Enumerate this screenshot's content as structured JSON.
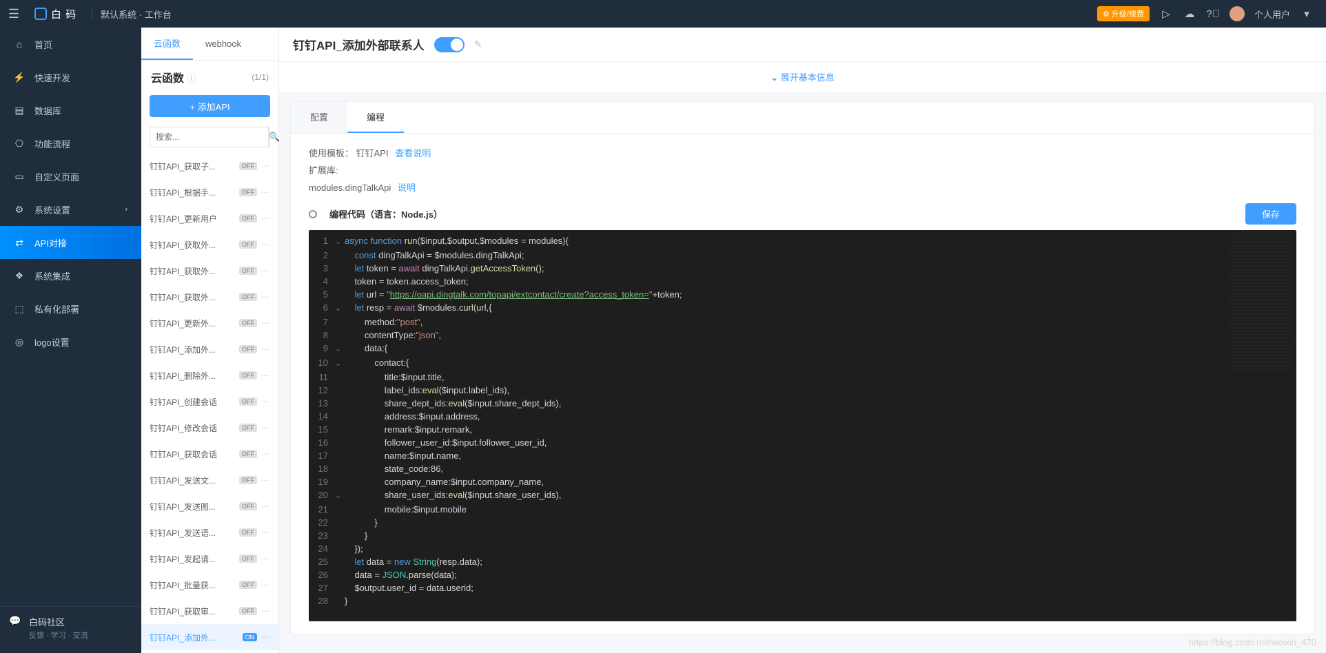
{
  "topbar": {
    "logo_text": "白 码",
    "breadcrumb": "默认系统 · 工作台",
    "upgrade": "升级/续费",
    "user": "个人用户"
  },
  "sidebar": {
    "items": [
      {
        "icon": "home",
        "label": "首页"
      },
      {
        "icon": "dev",
        "label": "快速开发"
      },
      {
        "icon": "db",
        "label": "数据库"
      },
      {
        "icon": "flow",
        "label": "功能流程"
      },
      {
        "icon": "page",
        "label": "自定义页面"
      },
      {
        "icon": "settings",
        "label": "系统设置",
        "arrow": true
      },
      {
        "icon": "api",
        "label": "API对接",
        "active": true
      },
      {
        "icon": "integrate",
        "label": "系统集成"
      },
      {
        "icon": "deploy",
        "label": "私有化部署"
      },
      {
        "icon": "logo",
        "label": "logo设置"
      }
    ],
    "footer_title": "白码社区",
    "footer_sub": "反馈 · 学习 · 交流"
  },
  "midpanel": {
    "tabs": [
      {
        "label": "云函数",
        "active": true
      },
      {
        "label": "webhook"
      }
    ],
    "title": "云函数",
    "count": "(1/1)",
    "add_btn": "+  添加API",
    "search_placeholder": "搜索...",
    "api_items": [
      {
        "name": "钉钉API_获取子...",
        "on": false
      },
      {
        "name": "钉钉API_根据手...",
        "on": false
      },
      {
        "name": "钉钉API_更新用户",
        "on": false
      },
      {
        "name": "钉钉API_获取外...",
        "on": false
      },
      {
        "name": "钉钉API_获取外...",
        "on": false
      },
      {
        "name": "钉钉API_获取外...",
        "on": false
      },
      {
        "name": "钉钉API_更新外...",
        "on": false
      },
      {
        "name": "钉钉API_添加外...",
        "on": false
      },
      {
        "name": "钉钉API_删除外...",
        "on": false
      },
      {
        "name": "钉钉API_创建会话",
        "on": false
      },
      {
        "name": "钉钉API_修改会话",
        "on": false
      },
      {
        "name": "钉钉API_获取会话",
        "on": false
      },
      {
        "name": "钉钉API_发送文...",
        "on": false
      },
      {
        "name": "钉钉API_发送图...",
        "on": false
      },
      {
        "name": "钉钉API_发送语...",
        "on": false
      },
      {
        "name": "钉钉API_发起请...",
        "on": false
      },
      {
        "name": "钉钉API_批量获...",
        "on": false
      },
      {
        "name": "钉钉API_获取审...",
        "on": false
      },
      {
        "name": "钉钉API_添加外...",
        "on": true,
        "selected": true
      }
    ]
  },
  "main": {
    "title": "钉钉API_添加外部联系人",
    "expand": "展开基本信息",
    "tabs": [
      {
        "label": "配置"
      },
      {
        "label": "编程",
        "active": true
      }
    ],
    "template_label": "使用模板：",
    "template_value": "钉钉API",
    "template_link": "查看说明",
    "ext_label": "扩展库:",
    "ext_value": "modules.dingTalkApi",
    "ext_link": "说明",
    "code_header": "编程代码（语言：Node.js）",
    "save": "保存",
    "code_lines": [
      {
        "n": 1,
        "fold": "⌄",
        "tokens": [
          [
            "kw",
            "async function "
          ],
          [
            "fn",
            "run"
          ],
          [
            "",
            "($input,$output,$modules = modules){"
          ]
        ]
      },
      {
        "n": 2,
        "tokens": [
          [
            "",
            "    "
          ],
          [
            "kw",
            "const"
          ],
          [
            "",
            " dingTalkApi = $modules.dingTalkApi;"
          ]
        ]
      },
      {
        "n": 3,
        "tokens": [
          [
            "",
            "    "
          ],
          [
            "kw",
            "let"
          ],
          [
            "",
            " token = "
          ],
          [
            "kw2",
            "await"
          ],
          [
            "",
            " dingTalkApi."
          ],
          [
            "fn",
            "getAccessToken"
          ],
          [
            "",
            "();"
          ]
        ]
      },
      {
        "n": 4,
        "tokens": [
          [
            "",
            "    token = token.access_token;"
          ]
        ]
      },
      {
        "n": 5,
        "tokens": [
          [
            "",
            "    "
          ],
          [
            "kw",
            "let"
          ],
          [
            "",
            " url = "
          ],
          [
            "str",
            "\""
          ],
          [
            "url",
            "https://oapi.dingtalk.com/topapi/extcontact/create?access_token="
          ],
          [
            "str",
            "\""
          ],
          [
            "",
            "+token;"
          ]
        ]
      },
      {
        "n": 6,
        "fold": "⌄",
        "tokens": [
          [
            "",
            "    "
          ],
          [
            "kw",
            "let"
          ],
          [
            "",
            " resp = "
          ],
          [
            "kw2",
            "await"
          ],
          [
            "",
            " $modules."
          ],
          [
            "fn",
            "curl"
          ],
          [
            "",
            "(url,{"
          ]
        ]
      },
      {
        "n": 7,
        "tokens": [
          [
            "",
            "        method:"
          ],
          [
            "str",
            "\"post\""
          ],
          [
            "",
            ","
          ]
        ]
      },
      {
        "n": 8,
        "tokens": [
          [
            "",
            "        contentType:"
          ],
          [
            "str",
            "\"json\""
          ],
          [
            "",
            ","
          ]
        ]
      },
      {
        "n": 9,
        "fold": "⌄",
        "tokens": [
          [
            "",
            "        data:{"
          ]
        ]
      },
      {
        "n": 10,
        "fold": "⌄",
        "tokens": [
          [
            "",
            "            contact:{"
          ]
        ]
      },
      {
        "n": 11,
        "tokens": [
          [
            "",
            "                title:$input.title,"
          ]
        ]
      },
      {
        "n": 12,
        "tokens": [
          [
            "",
            "                label_ids:"
          ],
          [
            "fn",
            "eval"
          ],
          [
            "",
            "($input.label_ids),"
          ]
        ]
      },
      {
        "n": 13,
        "tokens": [
          [
            "",
            "                share_dept_ids:"
          ],
          [
            "fn",
            "eval"
          ],
          [
            "",
            "($input.share_dept_ids),"
          ]
        ]
      },
      {
        "n": 14,
        "tokens": [
          [
            "",
            "                address:$input.address,"
          ]
        ]
      },
      {
        "n": 15,
        "tokens": [
          [
            "",
            "                remark:$input.remark,"
          ]
        ]
      },
      {
        "n": 16,
        "tokens": [
          [
            "",
            "                follower_user_id:$input.follower_user_id,"
          ]
        ]
      },
      {
        "n": 17,
        "tokens": [
          [
            "",
            "                name:$input.name,"
          ]
        ]
      },
      {
        "n": 18,
        "tokens": [
          [
            "",
            "                state_code:86,"
          ]
        ]
      },
      {
        "n": 19,
        "tokens": [
          [
            "",
            "                company_name:$input.company_name,"
          ]
        ]
      },
      {
        "n": 20,
        "fold": "⌄",
        "tokens": [
          [
            "",
            "                share_user_ids:"
          ],
          [
            "fn",
            "eval"
          ],
          [
            "",
            "($input.share_user_ids),"
          ]
        ]
      },
      {
        "n": 21,
        "tokens": [
          [
            "",
            "                mobile:$input.mobile"
          ]
        ]
      },
      {
        "n": 22,
        "tokens": [
          [
            "",
            "            }"
          ]
        ]
      },
      {
        "n": 23,
        "tokens": [
          [
            "",
            "        }"
          ]
        ]
      },
      {
        "n": 24,
        "tokens": [
          [
            "",
            "    });"
          ]
        ]
      },
      {
        "n": 25,
        "tokens": [
          [
            "",
            "    "
          ],
          [
            "kw",
            "let"
          ],
          [
            "",
            " data = "
          ],
          [
            "kw",
            "new "
          ],
          [
            "cls",
            "String"
          ],
          [
            "",
            "(resp.data);"
          ]
        ]
      },
      {
        "n": 26,
        "tokens": [
          [
            "",
            "    data = "
          ],
          [
            "cls",
            "JSON"
          ],
          [
            "",
            "."
          ],
          [
            "fn",
            "parse"
          ],
          [
            "",
            "(data);"
          ]
        ]
      },
      {
        "n": 27,
        "tokens": [
          [
            "",
            "    $output.user_id = data.userid;"
          ]
        ]
      },
      {
        "n": 28,
        "tokens": [
          [
            "",
            "}"
          ]
        ]
      }
    ]
  },
  "watermark": "https://blog.csdn.net/weixin_470"
}
